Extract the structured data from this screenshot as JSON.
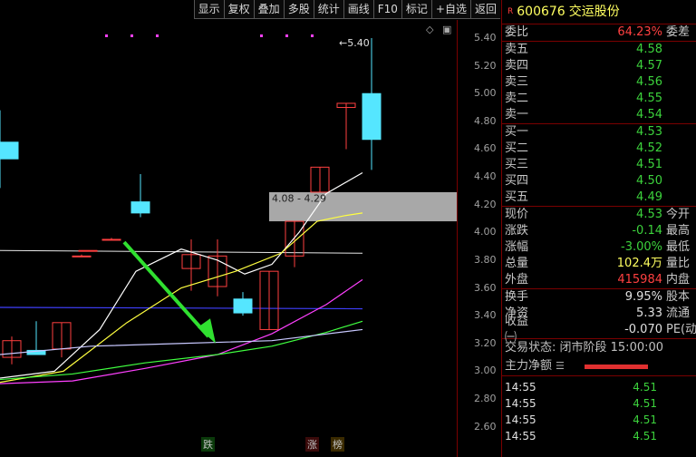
{
  "toolbar": [
    "显示",
    "复权",
    "叠加",
    "多股",
    "统计",
    "画线",
    "F10",
    "标记",
    "+自选",
    "返回"
  ],
  "chart": {
    "y_ticks": [
      "5.40",
      "5.20",
      "5.00",
      "4.80",
      "4.60",
      "4.40",
      "4.20",
      "4.00",
      "3.80",
      "3.60",
      "3.40",
      "3.20",
      "3.00",
      "2.80",
      "2.60"
    ],
    "high_label": "5.40",
    "zone_label": "4.08 - 4.29",
    "markers": [
      {
        "text": "跌",
        "color": "#3cd23c"
      },
      {
        "text": "涨",
        "color": "#ff4040"
      },
      {
        "text": "榜",
        "color": "#ffa500"
      }
    ],
    "colors": {
      "up": "#ff4040",
      "down": "#55e6ff",
      "ma1": "#ffffff",
      "ma2": "#ffff40",
      "ma3": "#ff40ff",
      "ma4": "#40ff40",
      "ma5": "#4040ff",
      "arrow": "#30e030"
    }
  },
  "chart_data": {
    "type": "candlestick",
    "candles": [
      {
        "o": 3.1,
        "h": 3.25,
        "l": 3.05,
        "c": 3.22
      },
      {
        "o": 3.15,
        "h": 3.36,
        "l": 3.13,
        "c": 3.12
      },
      {
        "o": 3.16,
        "h": 3.35,
        "l": 3.1,
        "c": 3.35
      },
      {
        "o": 3.95,
        "h": 3.96,
        "l": 3.95,
        "c": 3.95
      },
      {
        "o": 3.87,
        "h": 3.87,
        "l": 3.87,
        "c": 3.87
      },
      {
        "o": 3.83,
        "h": 3.84,
        "l": 3.83,
        "c": 3.83
      },
      {
        "o": 4.22,
        "h": 4.42,
        "l": 4.11,
        "c": 4.14
      },
      {
        "o": 3.74,
        "h": 3.95,
        "l": 3.58,
        "c": 3.84
      },
      {
        "o": 3.61,
        "h": 3.95,
        "l": 3.54,
        "c": 3.83
      },
      {
        "o": 3.52,
        "h": 3.57,
        "l": 3.4,
        "c": 3.42
      },
      {
        "o": 3.3,
        "h": 3.72,
        "l": 3.3,
        "c": 3.72
      },
      {
        "o": 3.83,
        "h": 4.08,
        "l": 3.75,
        "c": 4.08
      },
      {
        "o": 4.29,
        "h": 4.47,
        "l": 4.29,
        "c": 4.47
      },
      {
        "o": 4.9,
        "h": 4.93,
        "l": 4.6,
        "c": 4.93
      },
      {
        "o": 5.0,
        "h": 5.4,
        "l": 4.45,
        "c": 4.67
      },
      {
        "o": 4.65,
        "h": 4.88,
        "l": 4.32,
        "c": 4.53
      }
    ],
    "high_label": 5.4,
    "zone": [
      4.08,
      4.29
    ],
    "ylim": [
      2.6,
      5.4
    ]
  },
  "quote": {
    "code": "600676",
    "name": "交运股份",
    "weibi_label": "委比",
    "weibi_value": "64.23%",
    "weicha_label": "委差",
    "asks": [
      {
        "label": "卖五",
        "price": "4.58"
      },
      {
        "label": "卖四",
        "price": "4.57"
      },
      {
        "label": "卖三",
        "price": "4.56"
      },
      {
        "label": "卖二",
        "price": "4.55"
      },
      {
        "label": "卖一",
        "price": "4.54"
      }
    ],
    "bids": [
      {
        "label": "买一",
        "price": "4.53"
      },
      {
        "label": "买二",
        "price": "4.52"
      },
      {
        "label": "买三",
        "price": "4.51"
      },
      {
        "label": "买四",
        "price": "4.50"
      },
      {
        "label": "买五",
        "price": "4.49"
      }
    ],
    "stats": [
      {
        "label": "现价",
        "value": "4.53",
        "color": "g",
        "label2": "今开"
      },
      {
        "label": "涨跌",
        "value": "-0.14",
        "color": "g",
        "label2": "最高"
      },
      {
        "label": "涨幅",
        "value": "-3.00%",
        "color": "g",
        "label2": "最低"
      },
      {
        "label": "总量",
        "value": "102.4万",
        "color": "y",
        "label2": "量比"
      },
      {
        "label": "外盘",
        "value": "415984",
        "color": "r2",
        "label2": "内盘"
      }
    ],
    "stats2": [
      {
        "label": "换手",
        "value": "9.95%",
        "label2": "股本"
      },
      {
        "label": "净资",
        "value": "5.33",
        "label2": "流通"
      },
      {
        "label": "收益㈠",
        "value": "-0.070",
        "label2": "PE(动)"
      }
    ],
    "trade_status": "交易状态: 闭市阶段 15:00:00",
    "main_flow_label": "主力净额",
    "ticks": [
      {
        "time": "14:55",
        "price": "4.51"
      },
      {
        "time": "14:55",
        "price": "4.51"
      },
      {
        "time": "14:55",
        "price": "4.51"
      },
      {
        "time": "14:55",
        "price": "4.51"
      }
    ]
  }
}
